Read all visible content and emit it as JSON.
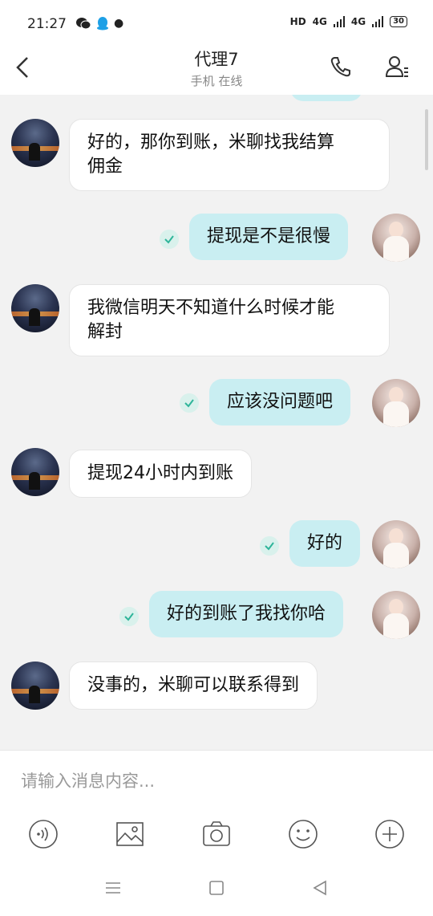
{
  "status_bar": {
    "time": "21:27",
    "right_labels": [
      "HD",
      "4G",
      "4G"
    ],
    "battery": "30",
    "app_icons": [
      "wechat-icon",
      "qq-icon"
    ]
  },
  "header": {
    "title": "代理7",
    "subtitle": "手机 在线"
  },
  "messages": [
    {
      "side": "left",
      "text_lines": [
        "好的，那你到账，米聊找我结算",
        "佣金"
      ]
    },
    {
      "side": "right",
      "text_lines": [
        "提现是不是很慢"
      ],
      "status": "read"
    },
    {
      "side": "left",
      "text_lines": [
        "我微信明天不知道什么时候才能",
        "解封"
      ]
    },
    {
      "side": "right",
      "text_lines": [
        "应该没问题吧"
      ],
      "status": "read"
    },
    {
      "side": "left",
      "text_lines": [
        "提现24小时内到账"
      ]
    },
    {
      "side": "right",
      "text_lines": [
        "好的"
      ],
      "status": "read"
    },
    {
      "side": "right",
      "text_lines": [
        "好的到账了我找你哈"
      ],
      "status": "read"
    },
    {
      "side": "left",
      "text_lines": [
        "没事的，米聊可以联系得到"
      ]
    }
  ],
  "input": {
    "placeholder": "请输入消息内容..."
  },
  "toolbar_icons": [
    "voice-icon",
    "image-icon",
    "camera-icon",
    "emoji-icon",
    "plus-icon"
  ],
  "nav_keys": [
    "menu-icon",
    "home-icon",
    "back-icon"
  ],
  "colors": {
    "sent_bubble": "#c9eef2",
    "received_bubble": "#ffffff",
    "check": "#2fb59a",
    "background": "#f2f2f2"
  }
}
